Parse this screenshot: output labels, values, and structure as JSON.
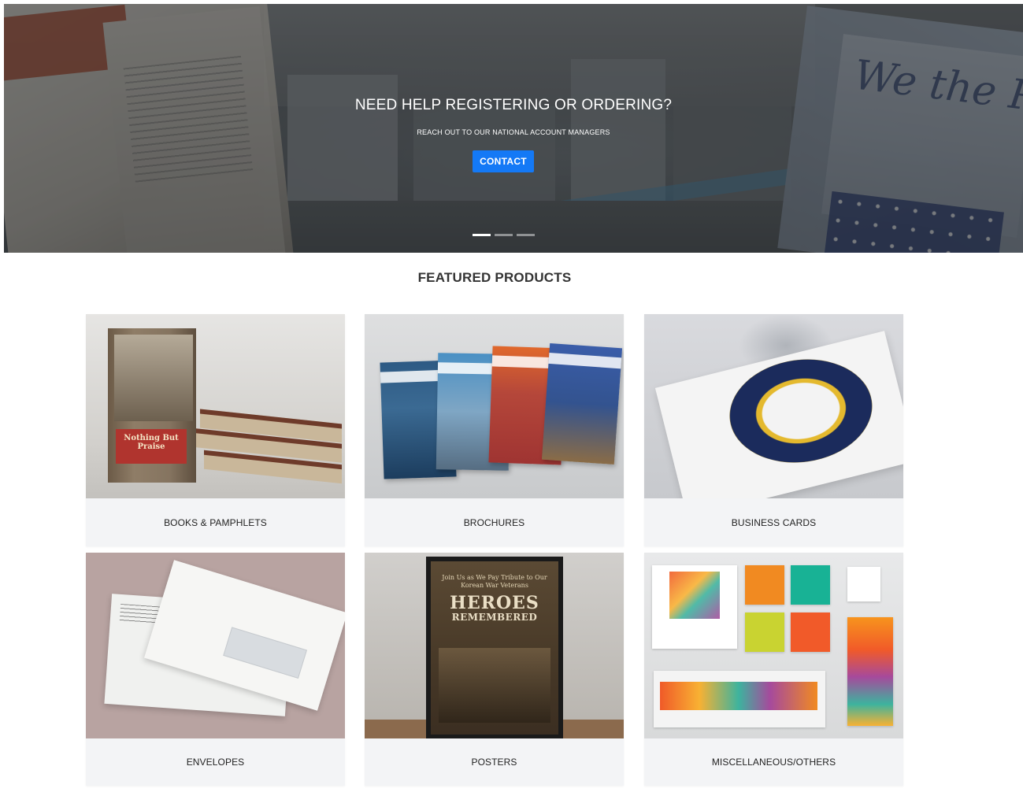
{
  "hero": {
    "title": "NEED HELP REGISTERING OR ORDERING?",
    "subtitle": "REACH OUT TO OUR NATIONAL ACCOUNT MANAGERS",
    "cta_label": "CONTACT",
    "slides": [
      {
        "active": true
      },
      {
        "active": false
      },
      {
        "active": false
      }
    ],
    "background_text": "We the Peo"
  },
  "featured": {
    "title": "FEATURED PRODUCTS",
    "products": [
      {
        "label": "BOOKS & PAMPHLETS",
        "image_text": "Nothing But Praise"
      },
      {
        "label": "BROCHURES"
      },
      {
        "label": "BUSINESS CARDS"
      },
      {
        "label": "ENVELOPES"
      },
      {
        "label": "POSTERS",
        "image_text_1": "Join Us as We Pay Tribute to Our Korean War Veterans",
        "image_text_2": "HEROES",
        "image_text_3": "REMEMBERED"
      },
      {
        "label": "MISCELLANEOUS/OTHERS"
      }
    ]
  },
  "colors": {
    "accent": "#1479f6",
    "card_bg": "#f3f4f6"
  }
}
